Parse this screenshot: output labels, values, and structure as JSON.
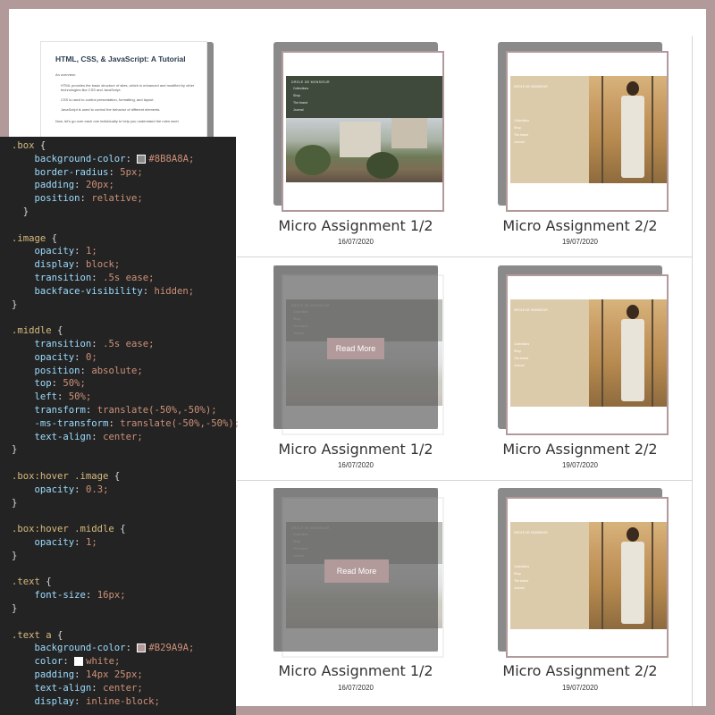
{
  "doc": {
    "title": "HTML, CSS, & JavaScript: A Tutorial",
    "intro": "An overview:",
    "bullets": [
      "HTML provides the basic structure of sites, which is enhanced and modified by other technologies like CSS and JavaScript.",
      "CSS is used to control presentation, formatting, and layout.",
      "JavaScript is used to control the behavior of different elements."
    ],
    "outro": "Now, let's go over each one individually to help you understand the roles each"
  },
  "cards": [
    {
      "caption": "Micro Assignment 1/2",
      "date": "16/07/2020"
    },
    {
      "caption": "Micro Assignment 2/2",
      "date": "19/07/2020"
    },
    {
      "caption": "Micro Assignment 1/2",
      "date": "16/07/2020"
    },
    {
      "caption": "Micro Assignment 2/2",
      "date": "19/07/2020"
    },
    {
      "caption": "Micro Assignment 1/2",
      "date": "16/07/2020"
    },
    {
      "caption": "Micro Assignment 2/2",
      "date": "19/07/2020"
    }
  ],
  "garden_site": {
    "brand": "DROLE DE MONSIEUR",
    "nav": [
      "Collections",
      "Shop",
      "The brand",
      "Journal"
    ]
  },
  "fashion_site": {
    "brand": "DROLE DE MONSIEUR",
    "nav": [
      "Collections",
      "Shop",
      "The brand",
      "Journal"
    ]
  },
  "read_more": "Read More",
  "code_lines": [
    ".box {",
    "    background-color: #8B8A8A;",
    "    border-radius: 5px;",
    "    padding: 20px;",
    "    position: relative;",
    "  }",
    "",
    ".image {",
    "    opacity: 1;",
    "    display: block;",
    "    transition: .5s ease;",
    "    backface-visibility: hidden;",
    "}",
    "",
    ".middle {",
    "    transition: .5s ease;",
    "    opacity: 0;",
    "    position: absolute;",
    "    top: 50%;",
    "    left: 50%;",
    "    transform: translate(-50%,-50%);",
    "    -ms-transform: translate(-50%,-50%);",
    "    text-align: center;",
    "}",
    "",
    ".box:hover .image {",
    "    opacity: 0.3;",
    "}",
    "",
    ".box:hover .middle {",
    "    opacity: 1;",
    "}",
    "",
    ".text {",
    "    font-size: 16px;",
    "}",
    "",
    ".text a {",
    "    background-color: #B29A9A;",
    "    color: white;",
    "    padding: 14px 25px;",
    "    text-align: center;",
    "    display: inline-block;"
  ],
  "colors": {
    "frame": "#B29A9A",
    "box": "#8B8A8A",
    "code_bg": "#232323"
  }
}
